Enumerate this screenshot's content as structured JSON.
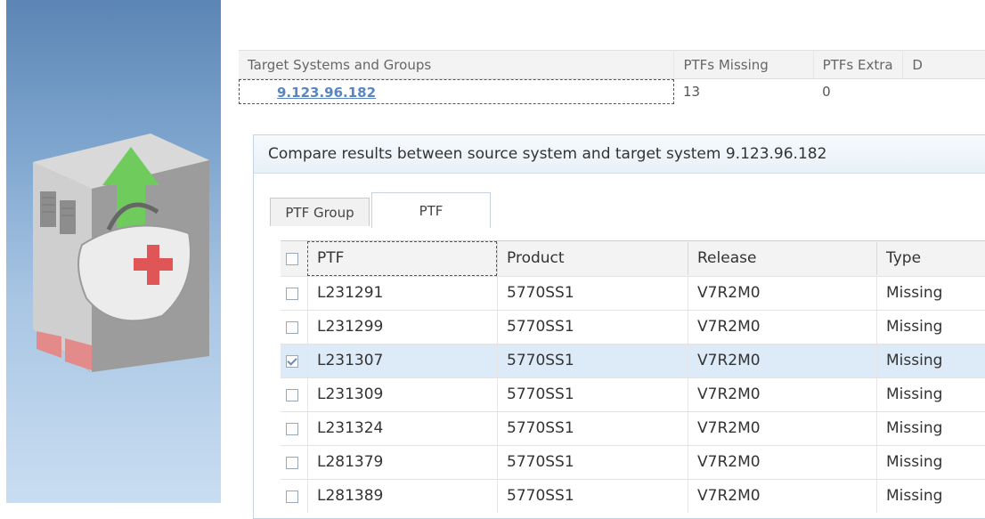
{
  "target_table": {
    "headers": {
      "systems": "Target Systems and Groups",
      "missing": "PTFs Missing",
      "extra": "PTFs Extra",
      "d": "D"
    },
    "rows": [
      {
        "system": "9.123.96.182",
        "missing": "13",
        "extra": "0"
      }
    ]
  },
  "compare": {
    "title": "Compare results between source system and target system 9.123.96.182",
    "tabs": [
      {
        "label": "PTF Group",
        "active": false
      },
      {
        "label": "PTF",
        "active": true
      }
    ],
    "grid": {
      "headers": {
        "ptf": "PTF",
        "product": "Product",
        "release": "Release",
        "type": "Type"
      },
      "rows": [
        {
          "ptf": "L231291",
          "product": "5770SS1",
          "release": "V7R2M0",
          "type": "Missing",
          "checked": false
        },
        {
          "ptf": "L231299",
          "product": "5770SS1",
          "release": "V7R2M0",
          "type": "Missing",
          "checked": false
        },
        {
          "ptf": "L231307",
          "product": "5770SS1",
          "release": "V7R2M0",
          "type": "Missing",
          "checked": true
        },
        {
          "ptf": "L231309",
          "product": "5770SS1",
          "release": "V7R2M0",
          "type": "Missing",
          "checked": false
        },
        {
          "ptf": "L231324",
          "product": "5770SS1",
          "release": "V7R2M0",
          "type": "Missing",
          "checked": false
        },
        {
          "ptf": "L281379",
          "product": "5770SS1",
          "release": "V7R2M0",
          "type": "Missing",
          "checked": false
        },
        {
          "ptf": "L281389",
          "product": "5770SS1",
          "release": "V7R2M0",
          "type": "Missing",
          "checked": false
        }
      ]
    }
  },
  "colors": {
    "link": "#5a86c0",
    "selected_row": "#ddeaf7",
    "panel_top": "#5b85b4",
    "panel_bottom": "#c9ddf1"
  },
  "icons": {
    "illustration": "server-with-medical-bag-icon",
    "arrow": "green-up-arrow-icon",
    "cross": "red-cross-icon"
  }
}
